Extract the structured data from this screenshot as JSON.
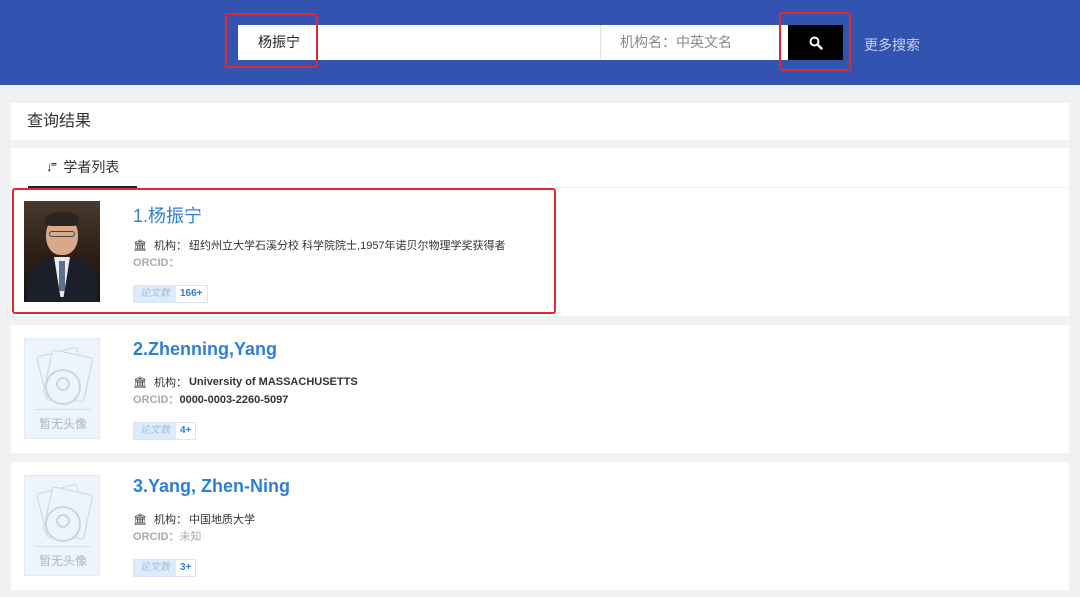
{
  "search": {
    "name_value": "杨振宁",
    "org_placeholder": "机构名：中英文名",
    "more_label": "更多搜索"
  },
  "results": {
    "heading": "查询结果",
    "tab_label": "学者列表",
    "tab_icon": "sort-desc-icon"
  },
  "labels": {
    "institution": "机构：",
    "orcid": "ORCID：",
    "papers": "论文数",
    "no_avatar": "暂无头像"
  },
  "scholars": [
    {
      "name": "1.杨振宁",
      "institution": "纽约州立大学石溪分校 科学院院士,1957年诺贝尔物理学奖获得者",
      "orcid": "",
      "papers": "166+"
    },
    {
      "name": "2.Zhenning,Yang",
      "institution": "University of MASSACHUSETTS",
      "orcid": "0000-0003-2260-5097",
      "papers": "4+"
    },
    {
      "name": "3.Yang, Zhen-Ning",
      "institution": "中国地质大学",
      "orcid": "未知",
      "papers": "3+"
    }
  ],
  "colors": {
    "header_bg": "#3353b0",
    "link_blue": "#2e7fd7",
    "highlight_red": "#e0282e"
  }
}
